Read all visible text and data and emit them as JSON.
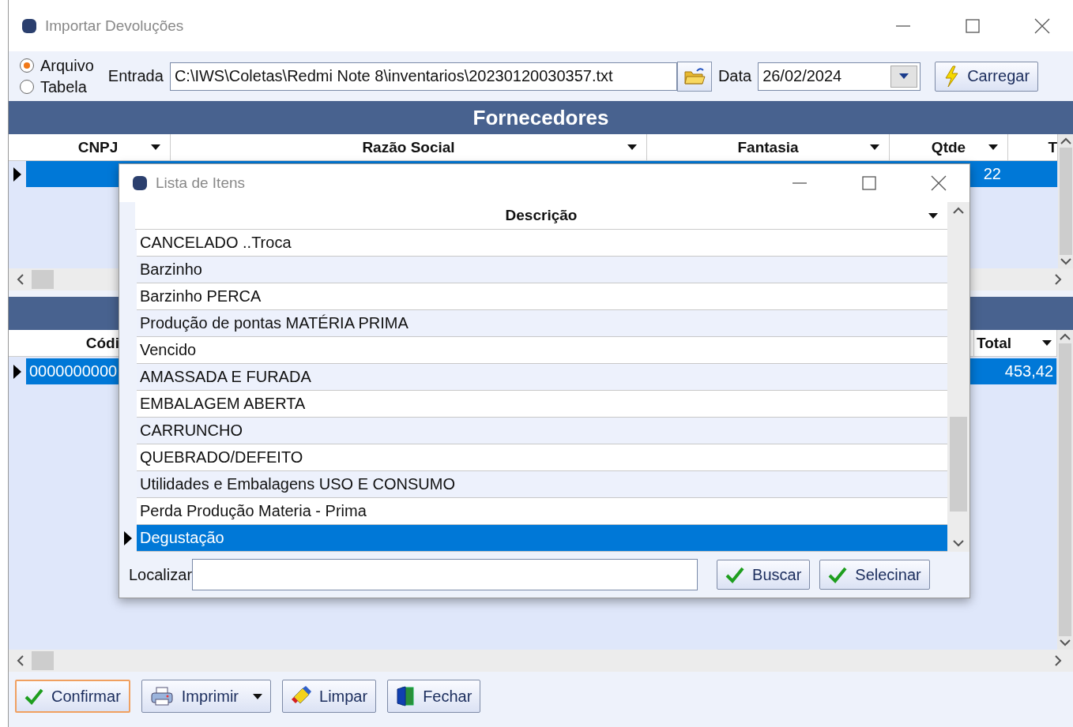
{
  "window": {
    "title": "Importar Devoluções"
  },
  "source": {
    "options": [
      {
        "label": "Arquivo",
        "selected": true
      },
      {
        "label": "Tabela",
        "selected": false
      }
    ],
    "entrada_label": "Entrada",
    "entrada_value": "C:\\IWS\\Coletas\\Redmi Note 8\\inventarios\\20230120030357.txt",
    "data_label": "Data",
    "data_value": "26/02/2024",
    "load_button": "Carregar"
  },
  "suppliers": {
    "title": "Fornecedores",
    "columns": [
      "CNPJ",
      "Razão Social",
      "Fantasia",
      "Qtde",
      "T"
    ],
    "rows": [
      {
        "selected": true,
        "qtde": "22"
      }
    ]
  },
  "items": {
    "columns": [
      "Códi",
      "Total"
    ],
    "rows": [
      {
        "selected": true,
        "codigo": "0000000000",
        "total": "453,42"
      }
    ]
  },
  "dialog": {
    "title": "Lista de Itens",
    "column": "Descrição",
    "rows": [
      {
        "text": "CANCELADO ..Troca",
        "selected": false
      },
      {
        "text": "Barzinho",
        "selected": false
      },
      {
        "text": "Barzinho PERCA",
        "selected": false
      },
      {
        "text": "Produção de pontas MATÉRIA PRIMA",
        "selected": false
      },
      {
        "text": "Vencido",
        "selected": false
      },
      {
        "text": "AMASSADA E FURADA",
        "selected": false
      },
      {
        "text": "EMBALAGEM ABERTA",
        "selected": false
      },
      {
        "text": "CARRUNCHO",
        "selected": false
      },
      {
        "text": "QUEBRADO/DEFEITO",
        "selected": false
      },
      {
        "text": "Utilidades e Embalagens USO E CONSUMO",
        "selected": false
      },
      {
        "text": "Perda Produção Materia - Prima",
        "selected": false
      },
      {
        "text": "Degustação",
        "selected": true
      }
    ],
    "search_label": "Localizar",
    "buttons": [
      "Buscar",
      "Selecinar"
    ]
  },
  "buttons": [
    {
      "label": "Confirmar",
      "kind": "confirm",
      "focused": true
    },
    {
      "label": "Imprimir",
      "kind": "print",
      "focused": false
    },
    {
      "label": "Limpar",
      "kind": "clear",
      "focused": false
    },
    {
      "label": "Fechar",
      "kind": "close",
      "focused": false
    }
  ]
}
